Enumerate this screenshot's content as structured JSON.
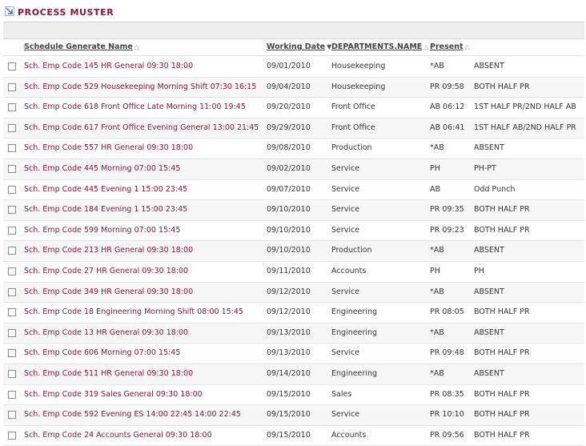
{
  "page": {
    "title": "PROCESS MUSTER"
  },
  "table": {
    "headers": {
      "name": "Schedule Generate Name",
      "date": "Working Date",
      "dept": "DEPARTMENTS.NAME",
      "present": "Present"
    },
    "rows": [
      {
        "name": "Sch. Emp Code 145 HR General 09:30 18:00",
        "date": "09/01/2010",
        "dept": "Housekeeping",
        "present": "*AB",
        "status": "ABSENT"
      },
      {
        "name": "Sch. Emp Code 529 Housekeeping Morning Shift 07:30 16:15",
        "date": "09/04/2010",
        "dept": "Housekeeping",
        "present": "PR 09:58",
        "status": "BOTH HALF PR"
      },
      {
        "name": "Sch. Emp Code 618 Front Office Late Morning 11:00 19:45",
        "date": "09/20/2010",
        "dept": "Front Office",
        "present": "AB 06:12",
        "status": "1ST HALF PR/2ND HALF AB"
      },
      {
        "name": "Sch. Emp Code 617 Front Office Evening General 13:00 21:45",
        "date": "09/29/2010",
        "dept": "Front Office",
        "present": "AB 06:41",
        "status": "1ST HALF AB/2ND HALF PR"
      },
      {
        "name": "Sch. Emp Code 557 HR General 09:30 18:00",
        "date": "09/08/2010",
        "dept": "Production",
        "present": "*AB",
        "status": "ABSENT"
      },
      {
        "name": "Sch. Emp Code 445 Morning 07:00 15:45",
        "date": "09/02/2010",
        "dept": "Service",
        "present": "PH",
        "status": "PH-PT"
      },
      {
        "name": "Sch. Emp Code 445 Evening 1 15:00 23:45",
        "date": "09/07/2010",
        "dept": "Service",
        "present": "AB",
        "status": "Odd Punch"
      },
      {
        "name": "Sch. Emp Code 184 Evening 1 15:00 23:45",
        "date": "09/10/2010",
        "dept": "Service",
        "present": "PR 09:35",
        "status": "BOTH HALF PR"
      },
      {
        "name": "Sch. Emp Code 599 Morning 07:00 15:45",
        "date": "09/10/2010",
        "dept": "Service",
        "present": "PR 09:23",
        "status": "BOTH HALF PR"
      },
      {
        "name": "Sch. Emp Code 213 HR General 09:30 18:00",
        "date": "09/10/2010",
        "dept": "Production",
        "present": "*AB",
        "status": "ABSENT"
      },
      {
        "name": "Sch. Emp Code 27 HR General 09:30 18:00",
        "date": "09/11/2010",
        "dept": "Accounts",
        "present": "PH",
        "status": "PH"
      },
      {
        "name": "Sch. Emp Code 349 HR General 09:30 18:00",
        "date": "09/12/2010",
        "dept": "Service",
        "present": "*AB",
        "status": "ABSENT"
      },
      {
        "name": "Sch. Emp Code 18 Engineering Morning Shift 08:00 15:45",
        "date": "09/12/2010",
        "dept": "Engineering",
        "present": "PR 08:05",
        "status": "BOTH HALF PR"
      },
      {
        "name": "Sch. Emp Code 13 HR General 09:30 18:00",
        "date": "09/13/2010",
        "dept": "Engineering",
        "present": "*AB",
        "status": "ABSENT"
      },
      {
        "name": "Sch. Emp Code 606 Morning 07:00 15:45",
        "date": "09/13/2010",
        "dept": "Service",
        "present": "PR 09:48",
        "status": "BOTH HALF PR"
      },
      {
        "name": "Sch. Emp Code 511 HR General 09:30 18:00",
        "date": "09/14/2010",
        "dept": "Engineering",
        "present": "*AB",
        "status": "ABSENT"
      },
      {
        "name": "Sch. Emp Code 319 Sales General 09:30 18:00",
        "date": "09/15/2010",
        "dept": "Sales",
        "present": "PR 08:35",
        "status": "BOTH HALF PR"
      },
      {
        "name": "Sch. Emp Code 592 Evening ES 14:00 22:45 14:00 22:45",
        "date": "09/15/2010",
        "dept": "Service",
        "present": "PR 10:10",
        "status": "BOTH HALF PR"
      },
      {
        "name": "Sch. Emp Code 24 Accounts General 09:30 18:00",
        "date": "09/15/2010",
        "dept": "Accounts",
        "present": "PR 09:56",
        "status": "BOTH HALF PR"
      }
    ]
  },
  "colors": {
    "accent": "#8a1538",
    "alt_row": "#f7f7f7",
    "toolbar": "#eeeeee"
  },
  "icons": {
    "title": "arrow-down-right-icon",
    "sort": "sort-arrow-icon",
    "sort_active": "sort-desc-icon"
  }
}
